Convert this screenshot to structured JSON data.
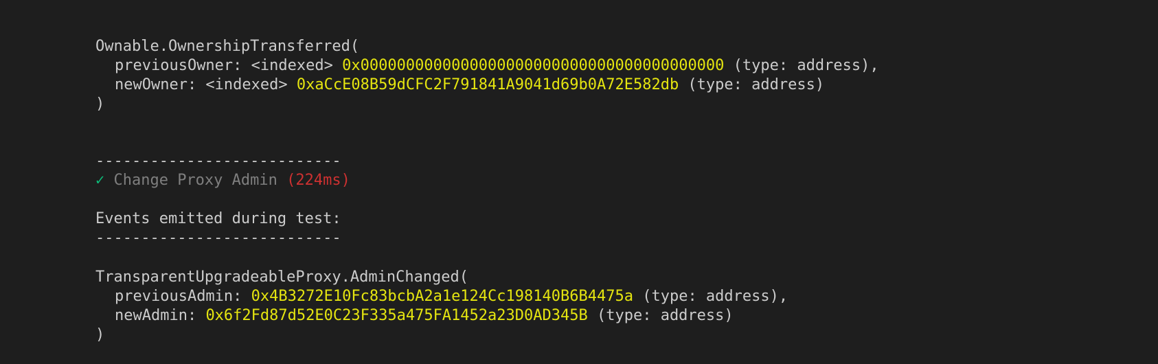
{
  "colors": {
    "background": "#1e1e1e",
    "text": "#cccccc",
    "address": "#e5e510",
    "pending_title": "#7f7f7f",
    "check": "#0dbc79",
    "duration": "#cd3131"
  },
  "ownership_event": {
    "header": "Ownable.OwnershipTransferred(",
    "previous_owner_label": "previousOwner: <indexed> ",
    "previous_owner_value": "0x0000000000000000000000000000000000000000",
    "previous_owner_type": " (type: address),",
    "new_owner_label": "newOwner: <indexed> ",
    "new_owner_value": "0xaCcE08B59dCFC2F791841A9041d69b0A72E582db",
    "new_owner_type": " (type: address)",
    "close": ")"
  },
  "separator_1": "---------------------------",
  "test_result": {
    "check_icon": "check-icon",
    "check_glyph": "✓",
    "title": " Change Proxy Admin ",
    "duration": "(224ms)"
  },
  "events_heading": "Events emitted during test:",
  "separator_2": "---------------------------",
  "admin_event": {
    "header": "TransparentUpgradeableProxy.AdminChanged(",
    "previous_admin_label": "previousAdmin: ",
    "previous_admin_value": "0x4B3272E10Fc83bcbA2a1e124Cc198140B6B4475a",
    "previous_admin_type": " (type: address),",
    "new_admin_label": "newAdmin: ",
    "new_admin_value": "0x6f2Fd87d52E0C23F335a475FA1452a23D0AD345B",
    "new_admin_type": " (type: address)",
    "close": ")"
  }
}
